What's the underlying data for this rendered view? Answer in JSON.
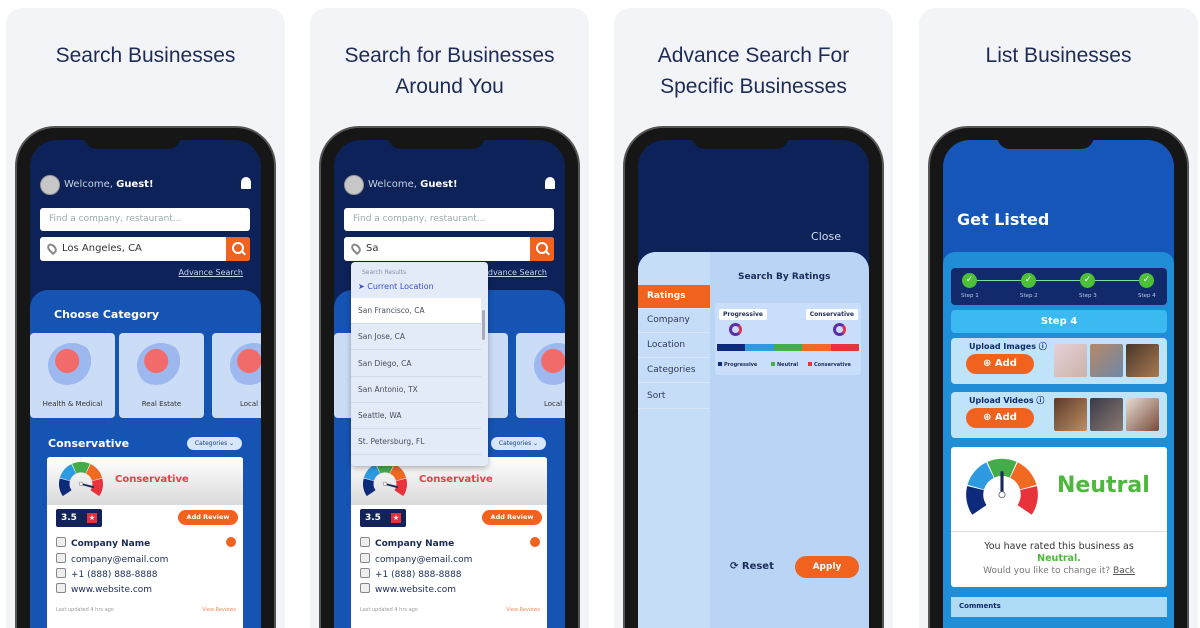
{
  "gauge_colors": [
    "#0e2a7a",
    "#2e9be0",
    "#44ad4a",
    "#f06a22",
    "#e8333c"
  ],
  "accent": "#f0621e",
  "panels": [
    {
      "title": "Search Businesses"
    },
    {
      "title": "Search for Businesses Around You"
    },
    {
      "title": "Advance Search For Specific Businesses"
    },
    {
      "title": "List Businesses"
    }
  ],
  "home": {
    "welcome": "Welcome, ",
    "user": "Guest!",
    "search_placeholder": "Find a company, restaurant...",
    "location_value": "Los Angeles, CA",
    "advance_search": "Advance Search",
    "choose_category": "Choose Category",
    "categories": [
      "Health & Medical",
      "Real Estate",
      "Local Se"
    ],
    "section": "Conservative",
    "categories_dropdown": "Categories ⌄",
    "business": {
      "rating_label": "Conservative",
      "rating": "3.5",
      "add_review": "Add Review",
      "name": "Company Name",
      "email": "company@email.com",
      "phone": "+1 (888) 888-8888",
      "website": "www.website.com",
      "last_updated": "Last updated 4 hrs ago",
      "view_reviews": "View Reviews"
    }
  },
  "location_search": {
    "query": "Sa",
    "header": "Search Results",
    "current_location": "Current Location",
    "results": [
      "San Francisco, CA",
      "San Jose, CA",
      "San Diego, CA",
      "San Antonio, TX",
      "Seattle, WA",
      "St. Petersburg, FL"
    ]
  },
  "advance": {
    "close": "Close",
    "tabs": [
      "Ratings",
      "Company",
      "Location",
      "Categories",
      "Sort"
    ],
    "active_tab": "Ratings",
    "heading": "Search By Ratings",
    "left_tag": "Progressive",
    "right_tag": "Conservative",
    "legend": [
      "Progressive",
      "Neutral",
      "Conservative"
    ],
    "reset": "Reset",
    "apply": "Apply"
  },
  "listing": {
    "title": "Get Listed",
    "steps": [
      "Step 1",
      "Step 2",
      "Step 3",
      "Step 4"
    ],
    "current_step": "Step 4",
    "upload_images": "Upload Images",
    "upload_videos": "Upload Videos",
    "add": "Add",
    "rating_value": "Neutral",
    "rated_text": "You have rated this business as",
    "rated_value": "Neutral.",
    "change_text": "Would you like to change it? ",
    "back": "Back",
    "comments": "Comments"
  }
}
